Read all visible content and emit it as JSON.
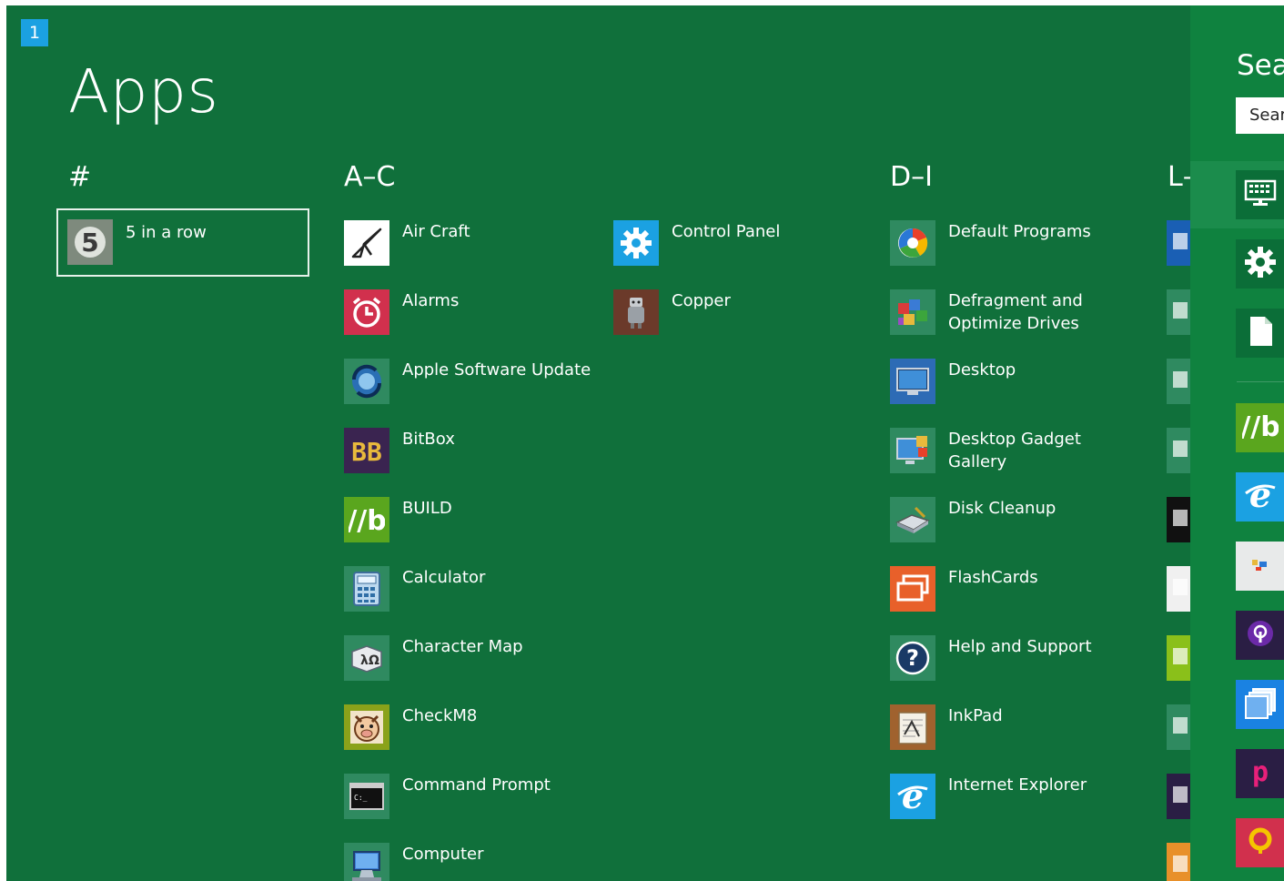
{
  "screen": {
    "badge": "1",
    "title": "Apps"
  },
  "groups": [
    {
      "header": "#"
    },
    {
      "header": "A–C"
    },
    {
      "header": "D–I"
    },
    {
      "header": "L–"
    }
  ],
  "apps_hash": [
    {
      "label": "5 in a row",
      "icon": "five-in-a-row-icon",
      "color": "#7e8a7d",
      "selected": true
    }
  ],
  "apps_ac_col1": [
    {
      "label": "Air Craft",
      "icon": "paper-plane-icon",
      "color": "#ffffff"
    },
    {
      "label": "Alarms",
      "icon": "alarm-clock-icon",
      "color": "#d1304d"
    },
    {
      "label": "Apple Software Update",
      "icon": "apple-update-icon",
      "color": "#2f8a60"
    },
    {
      "label": "BitBox",
      "icon": "bitbox-icon",
      "color": "#3a2450"
    },
    {
      "label": "BUILD",
      "icon": "build-icon",
      "color": "#5aa61e"
    },
    {
      "label": "Calculator",
      "icon": "calculator-icon",
      "color": "#2f8a60"
    },
    {
      "label": "Character Map",
      "icon": "character-map-icon",
      "color": "#2f8a60"
    },
    {
      "label": "CheckM8",
      "icon": "checkm8-icon",
      "color": "#8aa21a"
    },
    {
      "label": "Command Prompt",
      "icon": "command-prompt-icon",
      "color": "#2f8a60"
    },
    {
      "label": "Computer",
      "icon": "computer-icon",
      "color": "#2f8a60"
    }
  ],
  "apps_ac_col2": [
    {
      "label": "Control Panel",
      "icon": "control-panel-gear-icon",
      "color": "#1ba1e2"
    },
    {
      "label": "Copper",
      "icon": "copper-robot-icon",
      "color": "#6b3a2a"
    }
  ],
  "apps_di": [
    {
      "label": "Default Programs",
      "icon": "default-programs-icon",
      "color": "#2f8a60"
    },
    {
      "label": "Defragment and\nOptimize Drives",
      "icon": "defragment-icon",
      "color": "#2f8a60"
    },
    {
      "label": "Desktop",
      "icon": "desktop-icon",
      "color": "#2d6bb5"
    },
    {
      "label": "Desktop Gadget\nGallery",
      "icon": "gadget-gallery-icon",
      "color": "#2f8a60"
    },
    {
      "label": "Disk Cleanup",
      "icon": "disk-cleanup-icon",
      "color": "#2f8a60"
    },
    {
      "label": "FlashCards",
      "icon": "flashcards-icon",
      "color": "#e8602a"
    },
    {
      "label": "Help and Support",
      "icon": "help-icon",
      "color": "#2f8a60"
    },
    {
      "label": "InkPad",
      "icon": "inkpad-icon",
      "color": "#a0622e"
    },
    {
      "label": "Internet Explorer",
      "icon": "internet-explorer-icon",
      "color": "#1ba1e2"
    }
  ],
  "apps_l_partial": [
    {
      "icon": "partial-app-icon",
      "color": "#1a5fb4"
    },
    {
      "icon": "partial-app-icon",
      "color": "#2f8a60"
    },
    {
      "icon": "partial-app-icon",
      "color": "#2f8a60"
    },
    {
      "icon": "partial-app-icon",
      "color": "#2f8a60"
    },
    {
      "icon": "partial-app-icon",
      "color": "#111111"
    },
    {
      "icon": "partial-app-icon",
      "color": "#f0f0f0"
    },
    {
      "icon": "partial-app-icon",
      "color": "#8ac01a"
    },
    {
      "icon": "partial-app-icon",
      "color": "#2f8a60"
    },
    {
      "icon": "partial-app-icon",
      "color": "#2a1e44"
    },
    {
      "icon": "partial-app-icon",
      "color": "#e8902a"
    }
  ],
  "charms": {
    "title": "Sea",
    "search_value": "Sear",
    "items": [
      {
        "icon": "keyboard-icon",
        "color": "#0b6e38"
      },
      {
        "icon": "settings-gear-icon",
        "color": "#0b6e38"
      },
      {
        "icon": "document-icon",
        "color": "#0b6e38"
      },
      {
        "icon": "build-icon",
        "color": "#5aa61e"
      },
      {
        "icon": "internet-explorer-icon",
        "color": "#1ba1e2"
      },
      {
        "icon": "map-app-icon",
        "color": "#e8eaea"
      },
      {
        "icon": "podcast-icon",
        "color": "#2a1e44"
      },
      {
        "icon": "flashcards-stack-icon",
        "color": "#1a82e2"
      },
      {
        "icon": "p-app-icon",
        "color": "#2a1e44"
      },
      {
        "icon": "search-app-icon",
        "color": "#d1304d"
      }
    ]
  },
  "colors": {
    "background": "#10703b",
    "charm_bar": "#0f823f",
    "accent": "#1ba1e2"
  }
}
